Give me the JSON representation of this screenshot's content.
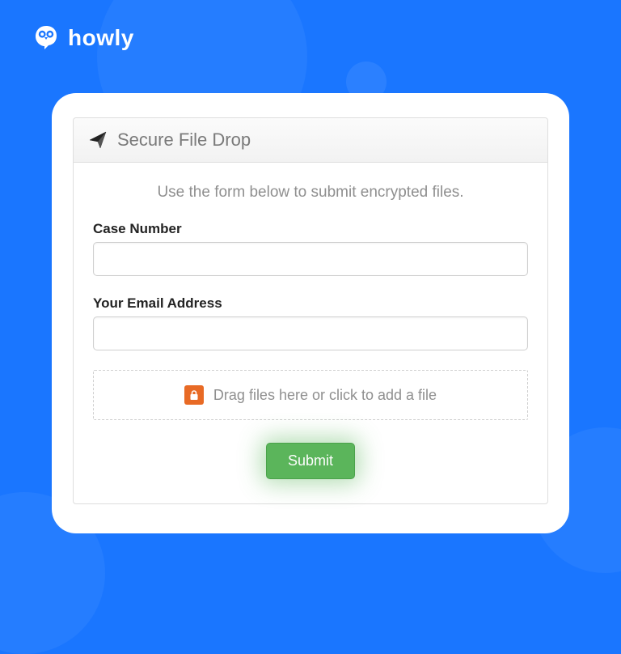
{
  "brand": {
    "name": "howly"
  },
  "panel": {
    "title": "Secure File Drop",
    "instructions": "Use the form below to submit encrypted files."
  },
  "fields": {
    "case_number": {
      "label": "Case Number",
      "value": ""
    },
    "email": {
      "label": "Your Email Address",
      "value": ""
    }
  },
  "dropzone": {
    "text": "Drag files here or click to add a file"
  },
  "actions": {
    "submit_label": "Submit"
  },
  "colors": {
    "background": "#1a76ff",
    "submit_button": "#5bb55b",
    "file_icon": "#e86a25"
  }
}
